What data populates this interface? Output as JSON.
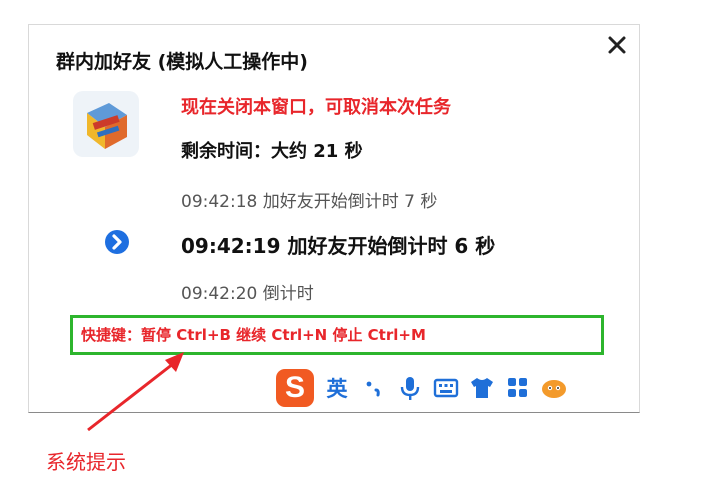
{
  "popup": {
    "title": "群内加好友 (模拟人工操作中)",
    "close_label": "✕",
    "warning": "现在关闭本窗口，可取消本次任务",
    "remaining": "剩余时间：大约 21 秒",
    "log": [
      "09:42:18 加好友开始倒计时 7 秒",
      "09:42:19 加好友开始倒计时 6 秒",
      "09:42:20 倒计时"
    ],
    "hotkeys": "快捷键：暂停 Ctrl+B  继续 Ctrl+N  停止 Ctrl+M"
  },
  "ime_toolbar": {
    "logo": "S",
    "language": "英",
    "punctuation": "•,",
    "icons": [
      "mic-icon",
      "keyboard-icon",
      "skin-icon",
      "toolbox-icon",
      "mascot-icon"
    ]
  },
  "annotation": {
    "label": "系统提示"
  },
  "colors": {
    "accent_red": "#e8262b",
    "highlight_green": "#2db52d",
    "ime_orange": "#f15a22",
    "ime_blue": "#1f6fd8",
    "arrow_blue": "#1e6fe0"
  }
}
